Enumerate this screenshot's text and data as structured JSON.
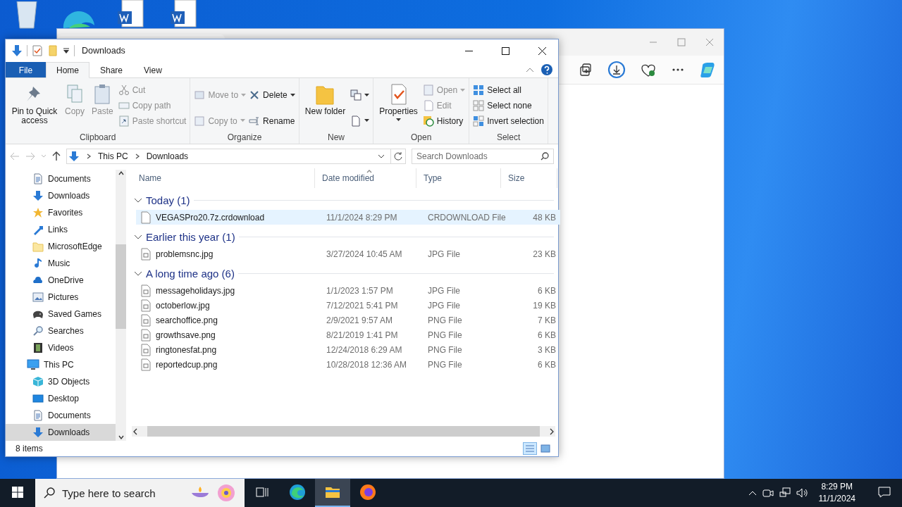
{
  "explorer": {
    "title": "Downloads",
    "ribbon_tabs": [
      {
        "label": "File",
        "selected": false,
        "kind": "file"
      },
      {
        "label": "Home",
        "selected": true,
        "kind": "tab"
      },
      {
        "label": "Share",
        "selected": false,
        "kind": "tab"
      },
      {
        "label": "View",
        "selected": false,
        "kind": "tab"
      }
    ],
    "ribbon_groups": [
      {
        "label": "Clipboard",
        "columns": [
          {
            "kind": "large",
            "buttons": [
              {
                "label": "Pin to Quick access",
                "disabled": false,
                "dropdown": false
              }
            ]
          },
          {
            "kind": "large",
            "buttons": [
              {
                "label": "Copy",
                "disabled": true,
                "dropdown": false
              }
            ]
          },
          {
            "kind": "large",
            "buttons": [
              {
                "label": "Paste",
                "disabled": true,
                "dropdown": false
              }
            ]
          },
          {
            "kind": "stack",
            "buttons": [
              {
                "label": "Cut",
                "disabled": true,
                "dropdown": false
              },
              {
                "label": "Copy path",
                "disabled": true,
                "dropdown": false
              },
              {
                "label": "Paste shortcut",
                "disabled": true,
                "dropdown": false
              }
            ]
          }
        ]
      },
      {
        "label": "Organize",
        "columns": [
          {
            "kind": "pair",
            "buttons": [
              {
                "label": "Move to",
                "disabled": true,
                "dropdown": true
              },
              {
                "label": "Copy to",
                "disabled": true,
                "dropdown": true
              }
            ]
          },
          {
            "kind": "pair",
            "buttons": [
              {
                "label": "Delete",
                "disabled": false,
                "dropdown": true
              },
              {
                "label": "Rename",
                "disabled": false,
                "dropdown": false
              }
            ]
          }
        ]
      },
      {
        "label": "New",
        "columns": [
          {
            "kind": "large",
            "buttons": [
              {
                "label": "New folder",
                "disabled": false,
                "dropdown": false
              }
            ]
          },
          {
            "kind": "pair",
            "buttons": [
              {
                "disabled": false,
                "dropdown": true
              },
              {
                "disabled": false,
                "dropdown": true
              }
            ]
          }
        ]
      },
      {
        "label": "Open",
        "columns": [
          {
            "kind": "large",
            "buttons": [
              {
                "label": "Properties",
                "disabled": false,
                "dropdown": true
              }
            ]
          },
          {
            "kind": "stack",
            "buttons": [
              {
                "label": "Open",
                "disabled": true,
                "dropdown": true
              },
              {
                "label": "Edit",
                "disabled": true,
                "dropdown": false
              },
              {
                "label": "History",
                "disabled": false,
                "dropdown": false
              }
            ]
          }
        ]
      },
      {
        "label": "Select",
        "columns": [
          {
            "kind": "stack",
            "buttons": [
              {
                "label": "Select all",
                "disabled": false,
                "dropdown": false
              },
              {
                "label": "Select none",
                "disabled": false,
                "dropdown": false
              },
              {
                "label": "Invert selection",
                "disabled": false,
                "dropdown": false
              }
            ]
          }
        ]
      }
    ],
    "breadcrumb": [
      "This PC",
      "Downloads"
    ],
    "search": {
      "placeholder": "Search Downloads"
    },
    "nav_pane": {
      "items": [
        {
          "label": "Documents",
          "selected": false
        },
        {
          "label": "Downloads",
          "selected": false
        },
        {
          "label": "Favorites",
          "selected": false
        },
        {
          "label": "Links",
          "selected": false
        },
        {
          "label": "MicrosoftEdge",
          "selected": false
        },
        {
          "label": "Music",
          "selected": false
        },
        {
          "label": "OneDrive",
          "selected": false
        },
        {
          "label": "Pictures",
          "selected": false
        },
        {
          "label": "Saved Games",
          "selected": false
        },
        {
          "label": "Searches",
          "selected": false
        },
        {
          "label": "Videos",
          "selected": false
        },
        {
          "label": "This PC",
          "selected": false,
          "children": [
            {
              "label": "3D Objects",
              "selected": false
            },
            {
              "label": "Desktop",
              "selected": false
            },
            {
              "label": "Documents",
              "selected": false
            },
            {
              "label": "Downloads",
              "selected": true
            }
          ]
        }
      ]
    },
    "columns": [
      {
        "label": "Name",
        "sorted": false
      },
      {
        "label": "Date modified",
        "sorted": true
      },
      {
        "label": "Type",
        "sorted": false
      },
      {
        "label": "Size",
        "sorted": false
      }
    ],
    "groups": [
      {
        "label": "Today (1)",
        "expanded": true,
        "rows": [
          {
            "name": "VEGASPro20.7z.crdownload",
            "date": "11/1/2024 8:29 PM",
            "type": "CRDOWNLOAD File",
            "size": "48 KB",
            "selected": true
          }
        ]
      },
      {
        "label": "Earlier this year (1)",
        "expanded": true,
        "rows": [
          {
            "name": "problemsnc.jpg",
            "date": "3/27/2024 10:45 AM",
            "type": "JPG File",
            "size": "23 KB",
            "selected": false
          }
        ]
      },
      {
        "label": "A long time ago (6)",
        "expanded": true,
        "rows": [
          {
            "name": "messageholidays.jpg",
            "date": "1/1/2023 1:57 PM",
            "type": "JPG File",
            "size": "6 KB",
            "selected": false
          },
          {
            "name": "octoberlow.jpg",
            "date": "7/12/2021 5:41 PM",
            "type": "JPG File",
            "size": "19 KB",
            "selected": false
          },
          {
            "name": "searchoffice.png",
            "date": "2/9/2021 9:57 AM",
            "type": "PNG File",
            "size": "7 KB",
            "selected": false
          },
          {
            "name": "growthsave.png",
            "date": "8/21/2019 1:41 PM",
            "type": "PNG File",
            "size": "6 KB",
            "selected": false
          },
          {
            "name": "ringtonesfat.png",
            "date": "12/24/2018 6:29 AM",
            "type": "PNG File",
            "size": "3 KB",
            "selected": false
          },
          {
            "name": "reportedcup.png",
            "date": "10/28/2018 12:36 AM",
            "type": "PNG File",
            "size": "6 KB",
            "selected": false
          }
        ]
      }
    ],
    "status": "8 items",
    "views": [
      {
        "kind": "details",
        "selected": true
      },
      {
        "kind": "large-icons",
        "selected": false
      }
    ]
  },
  "taskbar": {
    "search": {
      "placeholder": "Type here to search"
    },
    "apps": [
      {
        "kind": "edge",
        "selected": false
      },
      {
        "kind": "explorer",
        "selected": true
      },
      {
        "kind": "firefox",
        "selected": false
      }
    ],
    "time": "8:29 PM",
    "date": "11/1/2024"
  }
}
